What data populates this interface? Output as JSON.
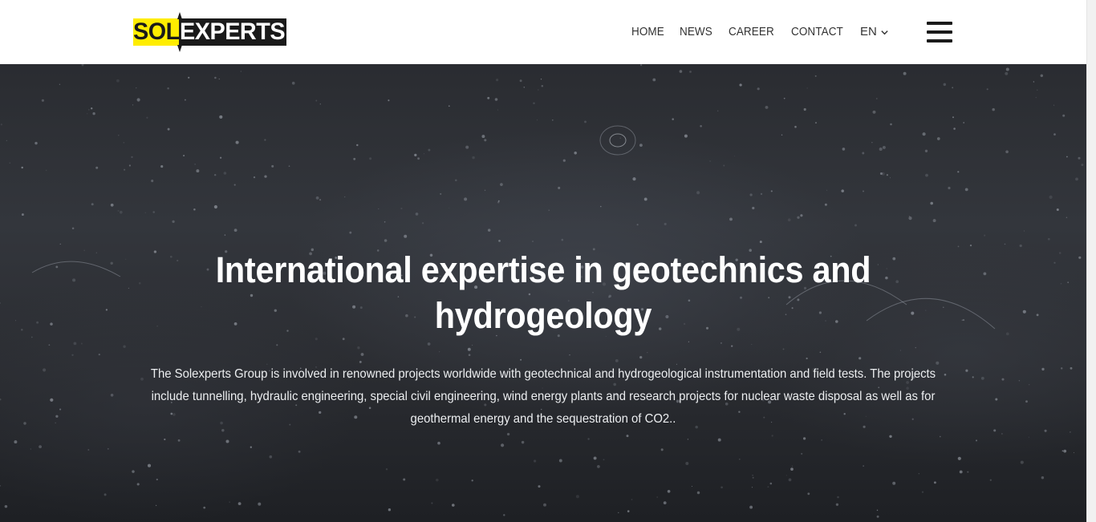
{
  "logo": {
    "part1": "SOL",
    "part2": "EXPERTS",
    "yellow": "#ffed00",
    "dark": "#1a1a1a"
  },
  "nav": {
    "items": [
      {
        "label": "HOME"
      },
      {
        "label": "NEWS"
      },
      {
        "label": "CAREER"
      },
      {
        "label": "CONTACT"
      }
    ],
    "language": "EN",
    "language_icon": "chevron-down-icon",
    "menu_icon": "hamburger-menu-icon"
  },
  "hero": {
    "title": "International expertise in geotechnics and hydrogeology",
    "text": "The Solexperts Group is involved in renowned projects worldwide with geotechnical and hydrogeological instrumentation and field tests. The projects include tunnelling, hydraulic engineering, special civil engineering, wind energy plants and research projects for nuclear waste disposal as well as for geothermal energy and the sequestration of CO2..",
    "background": "dark rain water surface"
  }
}
